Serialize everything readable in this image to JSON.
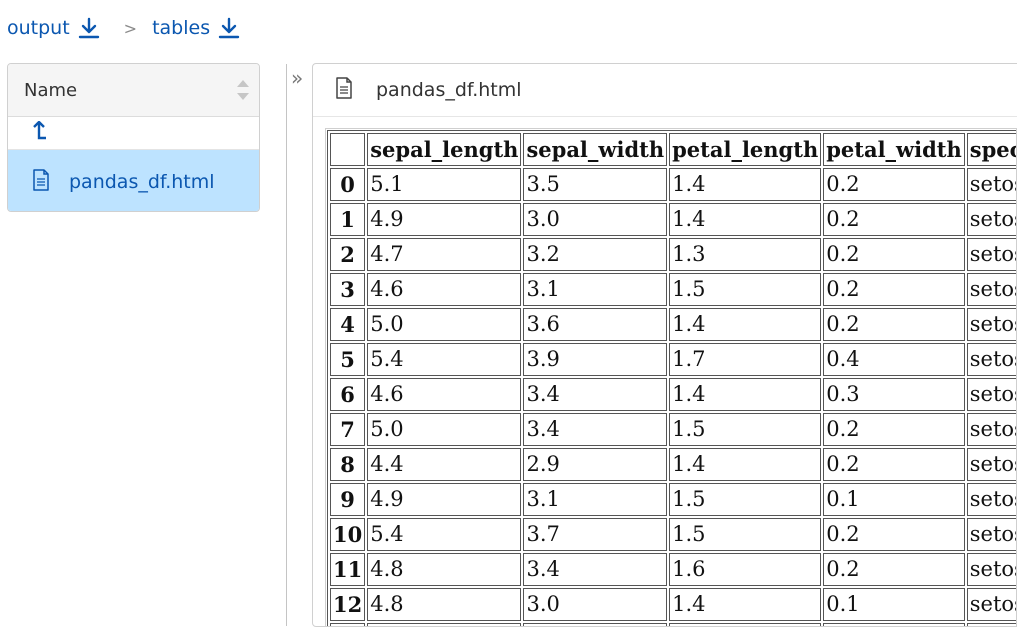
{
  "breadcrumb": [
    {
      "label": "output"
    },
    {
      "label": "tables"
    }
  ],
  "breadcrumb_separator": ">",
  "file_panel": {
    "column_header": "Name",
    "up_icon": "level-up-icon",
    "files": [
      {
        "name": "pandas_df.html",
        "icon": "document-icon",
        "selected": true
      }
    ]
  },
  "viewer": {
    "collapse_toggle": "»",
    "title": "pandas_df.html",
    "table": {
      "columns": [
        "",
        "sepal_length",
        "sepal_width",
        "petal_length",
        "petal_width",
        "species"
      ],
      "rows": [
        [
          "0",
          "5.1",
          "3.5",
          "1.4",
          "0.2",
          "setosa"
        ],
        [
          "1",
          "4.9",
          "3.0",
          "1.4",
          "0.2",
          "setosa"
        ],
        [
          "2",
          "4.7",
          "3.2",
          "1.3",
          "0.2",
          "setosa"
        ],
        [
          "3",
          "4.6",
          "3.1",
          "1.5",
          "0.2",
          "setosa"
        ],
        [
          "4",
          "5.0",
          "3.6",
          "1.4",
          "0.2",
          "setosa"
        ],
        [
          "5",
          "5.4",
          "3.9",
          "1.7",
          "0.4",
          "setosa"
        ],
        [
          "6",
          "4.6",
          "3.4",
          "1.4",
          "0.3",
          "setosa"
        ],
        [
          "7",
          "5.0",
          "3.4",
          "1.5",
          "0.2",
          "setosa"
        ],
        [
          "8",
          "4.4",
          "2.9",
          "1.4",
          "0.2",
          "setosa"
        ],
        [
          "9",
          "4.9",
          "3.1",
          "1.5",
          "0.1",
          "setosa"
        ],
        [
          "10",
          "5.4",
          "3.7",
          "1.5",
          "0.2",
          "setosa"
        ],
        [
          "11",
          "4.8",
          "3.4",
          "1.6",
          "0.2",
          "setosa"
        ],
        [
          "12",
          "4.8",
          "3.0",
          "1.4",
          "0.1",
          "setosa"
        ],
        [
          "",
          "",
          "",
          "",
          "",
          ""
        ]
      ]
    }
  },
  "colors": {
    "link": "#0b57b0",
    "selected_row": "#bde3ff",
    "header_bg": "#f5f5f5"
  }
}
